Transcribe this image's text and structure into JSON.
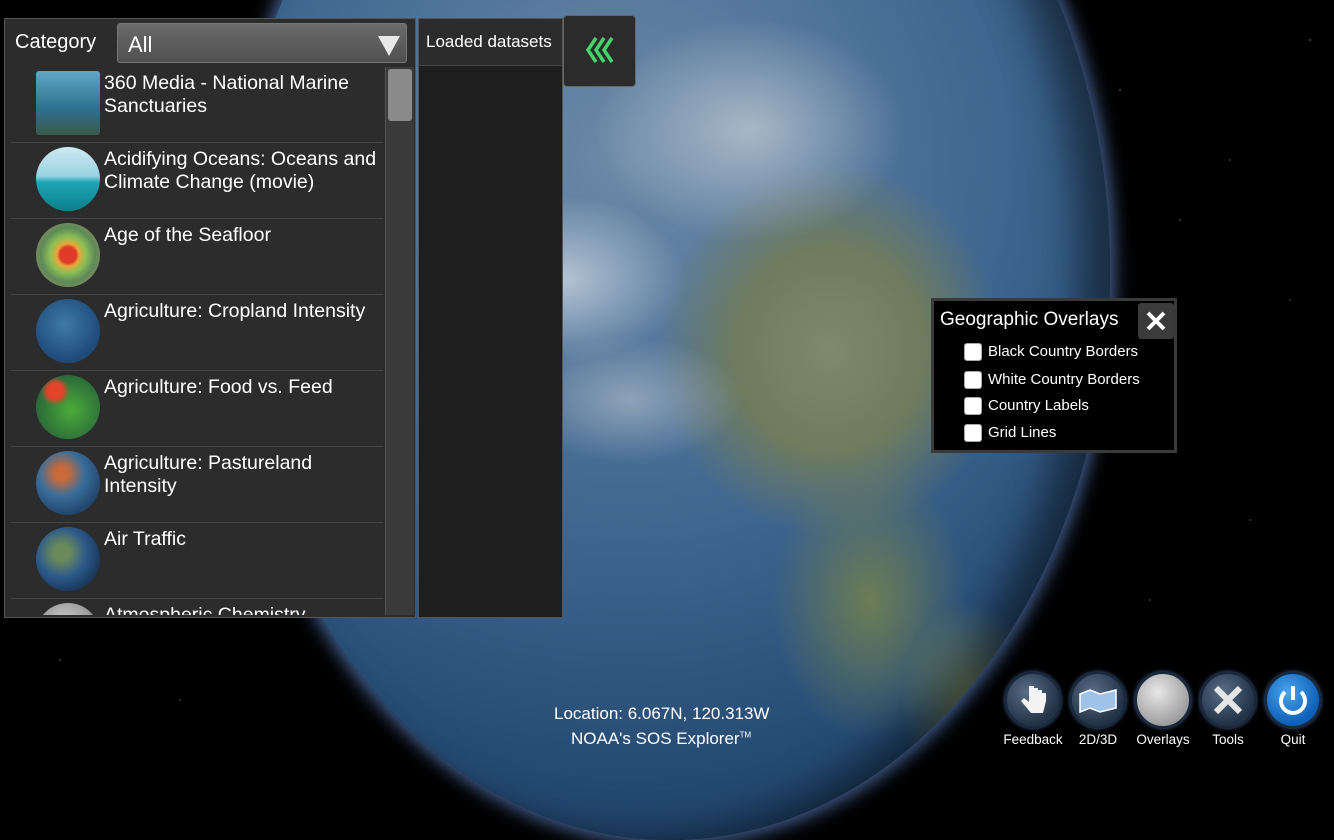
{
  "category": {
    "label": "Category",
    "selected": "All"
  },
  "datasets": [
    {
      "title": "360 Media - National Marine Sanctuaries",
      "thumb": "underwater-statue"
    },
    {
      "title": "Acidifying Oceans: Oceans and Climate Change (movie)",
      "thumb": "ocean-ship"
    },
    {
      "title": "Age of the Seafloor",
      "thumb": "seafloor-age"
    },
    {
      "title": "Agriculture: Cropland Intensity",
      "thumb": "cropland"
    },
    {
      "title": "Agriculture: Food vs. Feed",
      "thumb": "food-feed"
    },
    {
      "title": "Agriculture: Pastureland Intensity",
      "thumb": "pastureland"
    },
    {
      "title": "Air Traffic",
      "thumb": "air-traffic"
    },
    {
      "title": "Atmospheric Chemistry",
      "thumb": "atmospheric"
    }
  ],
  "loaded": {
    "header": "Loaded datasets"
  },
  "overlays": {
    "title": "Geographic Overlays",
    "items": [
      {
        "label": "Black Country Borders",
        "checked": false
      },
      {
        "label": "White Country Borders",
        "checked": false
      },
      {
        "label": "Country Labels",
        "checked": false
      },
      {
        "label": "Grid Lines",
        "checked": false
      }
    ]
  },
  "location": "Location: 6.067N, 120.313W",
  "app_name": "NOAA's SOS Explorer",
  "trademark": "TM",
  "toolbar": [
    {
      "label": "Feedback",
      "icon": "hand-pointer-icon"
    },
    {
      "label": "2D/3D",
      "icon": "map-fold-icon"
    },
    {
      "label": "Overlays",
      "icon": "globe-overlay-icon"
    },
    {
      "label": "Tools",
      "icon": "tools-icon"
    },
    {
      "label": "Quit",
      "icon": "power-icon"
    }
  ]
}
